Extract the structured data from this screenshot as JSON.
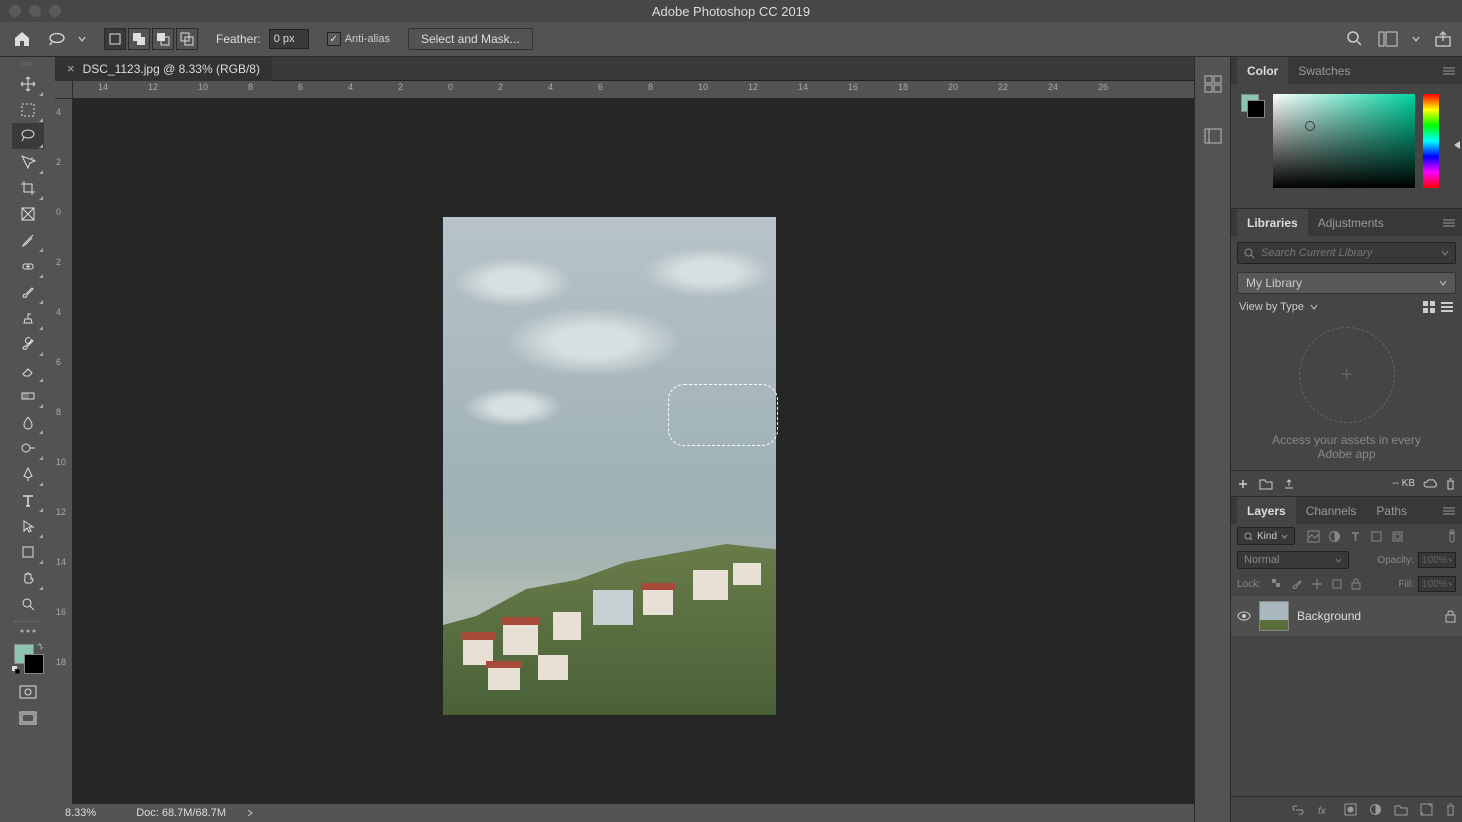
{
  "app_title": "Adobe Photoshop CC 2019",
  "document": {
    "tab_label": "DSC_1123.jpg @ 8.33% (RGB/8)",
    "zoom": "8.33%",
    "doc_info": "Doc: 68.7M/68.7M"
  },
  "options_bar": {
    "feather_label": "Feather:",
    "feather_value": "0 px",
    "anti_alias_label": "Anti-alias",
    "select_mask_label": "Select and Mask..."
  },
  "ruler_h": [
    "14",
    "12",
    "10",
    "8",
    "6",
    "4",
    "2",
    "0",
    "2",
    "4",
    "6",
    "8",
    "10",
    "12",
    "14",
    "16",
    "18",
    "20",
    "22",
    "24",
    "26"
  ],
  "ruler_v": [
    "4",
    "2",
    "0",
    "2",
    "4",
    "6",
    "8",
    "10",
    "12",
    "14",
    "16",
    "18"
  ],
  "panels": {
    "color": {
      "tab": "Color",
      "swatches_tab": "Swatches"
    },
    "libraries": {
      "tab": "Libraries",
      "adjustments_tab": "Adjustments",
      "search_placeholder": "Search Current Library",
      "dropdown": "My Library",
      "view_label": "View by Type",
      "drop_text1": "Access your assets in every",
      "drop_text2": "Adobe app",
      "kb": "-- KB"
    },
    "layers": {
      "tab": "Layers",
      "channels_tab": "Channels",
      "paths_tab": "Paths",
      "kind": "Kind",
      "blend_mode": "Normal",
      "opacity_label": "Opacity:",
      "opacity_value": "100%",
      "lock_label": "Lock:",
      "fill_label": "Fill:",
      "fill_value": "100%",
      "layer_name": "Background"
    }
  },
  "colors": {
    "foreground": "#8bc4b3",
    "background": "#000000"
  }
}
